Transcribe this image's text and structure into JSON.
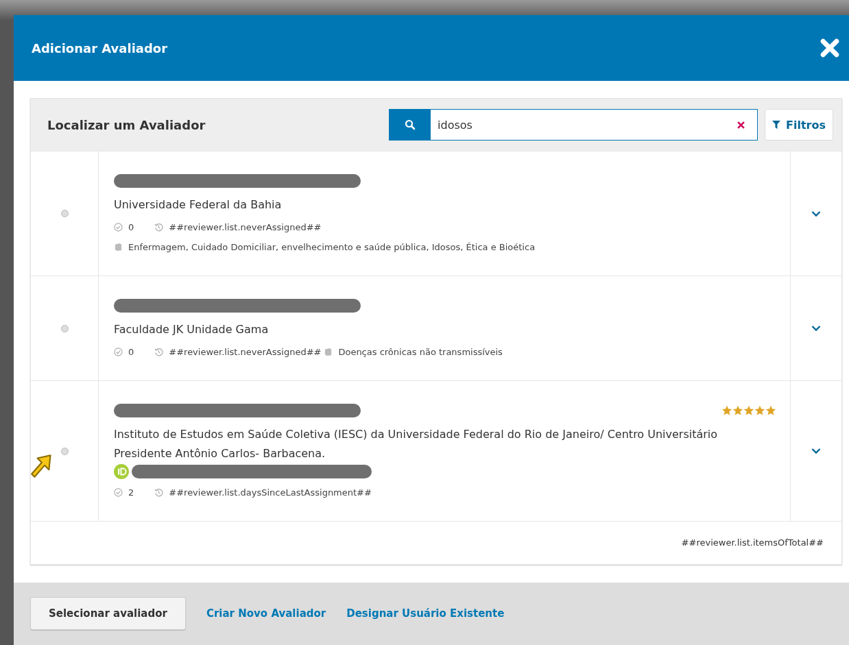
{
  "modal": {
    "title": "Adicionar Avaliador"
  },
  "panel": {
    "title": "Localizar um Avaliador",
    "search": {
      "value": "idosos"
    },
    "filter_button": "Filtros"
  },
  "reviewers": [
    {
      "kind": "stacked",
      "name_redacted": true,
      "affiliation": "Universidade Federal da Bahia",
      "completed": "0",
      "last_assignment": "##reviewer.list.neverAssigned##",
      "interests": "Enfermagem, Cuidado Domiciliar, envelhecimento e saúde pública, Idosos, Ética e Bioética",
      "selected": false,
      "expanded": false
    },
    {
      "kind": "inline",
      "name_redacted": true,
      "affiliation": "Faculdade JK Unidade Gama",
      "completed": "0",
      "last_assignment": "##reviewer.list.neverAssigned##",
      "interests": "Doenças crônicas não transmissíveis",
      "selected": false,
      "expanded": false
    },
    {
      "kind": "stacked",
      "name_redacted": true,
      "stars": 5,
      "affiliation": "Instituto de Estudos em Saúde Coletiva (IESC) da Universidade Federal do Rio de Janeiro/ Centro Universitário Presidente Antônio Carlos- Barbacena.",
      "orcid_redacted": true,
      "completed": "2",
      "last_assignment": "##reviewer.list.daysSinceLastAssignment##",
      "selected": false,
      "expanded": false
    }
  ],
  "list_footer": "##reviewer.list.itemsOfTotal##",
  "footer": {
    "primary_button": "Selecionar avaliador",
    "links": [
      "Criar Novo Avaliador",
      "Designar Usuário Existente"
    ]
  }
}
